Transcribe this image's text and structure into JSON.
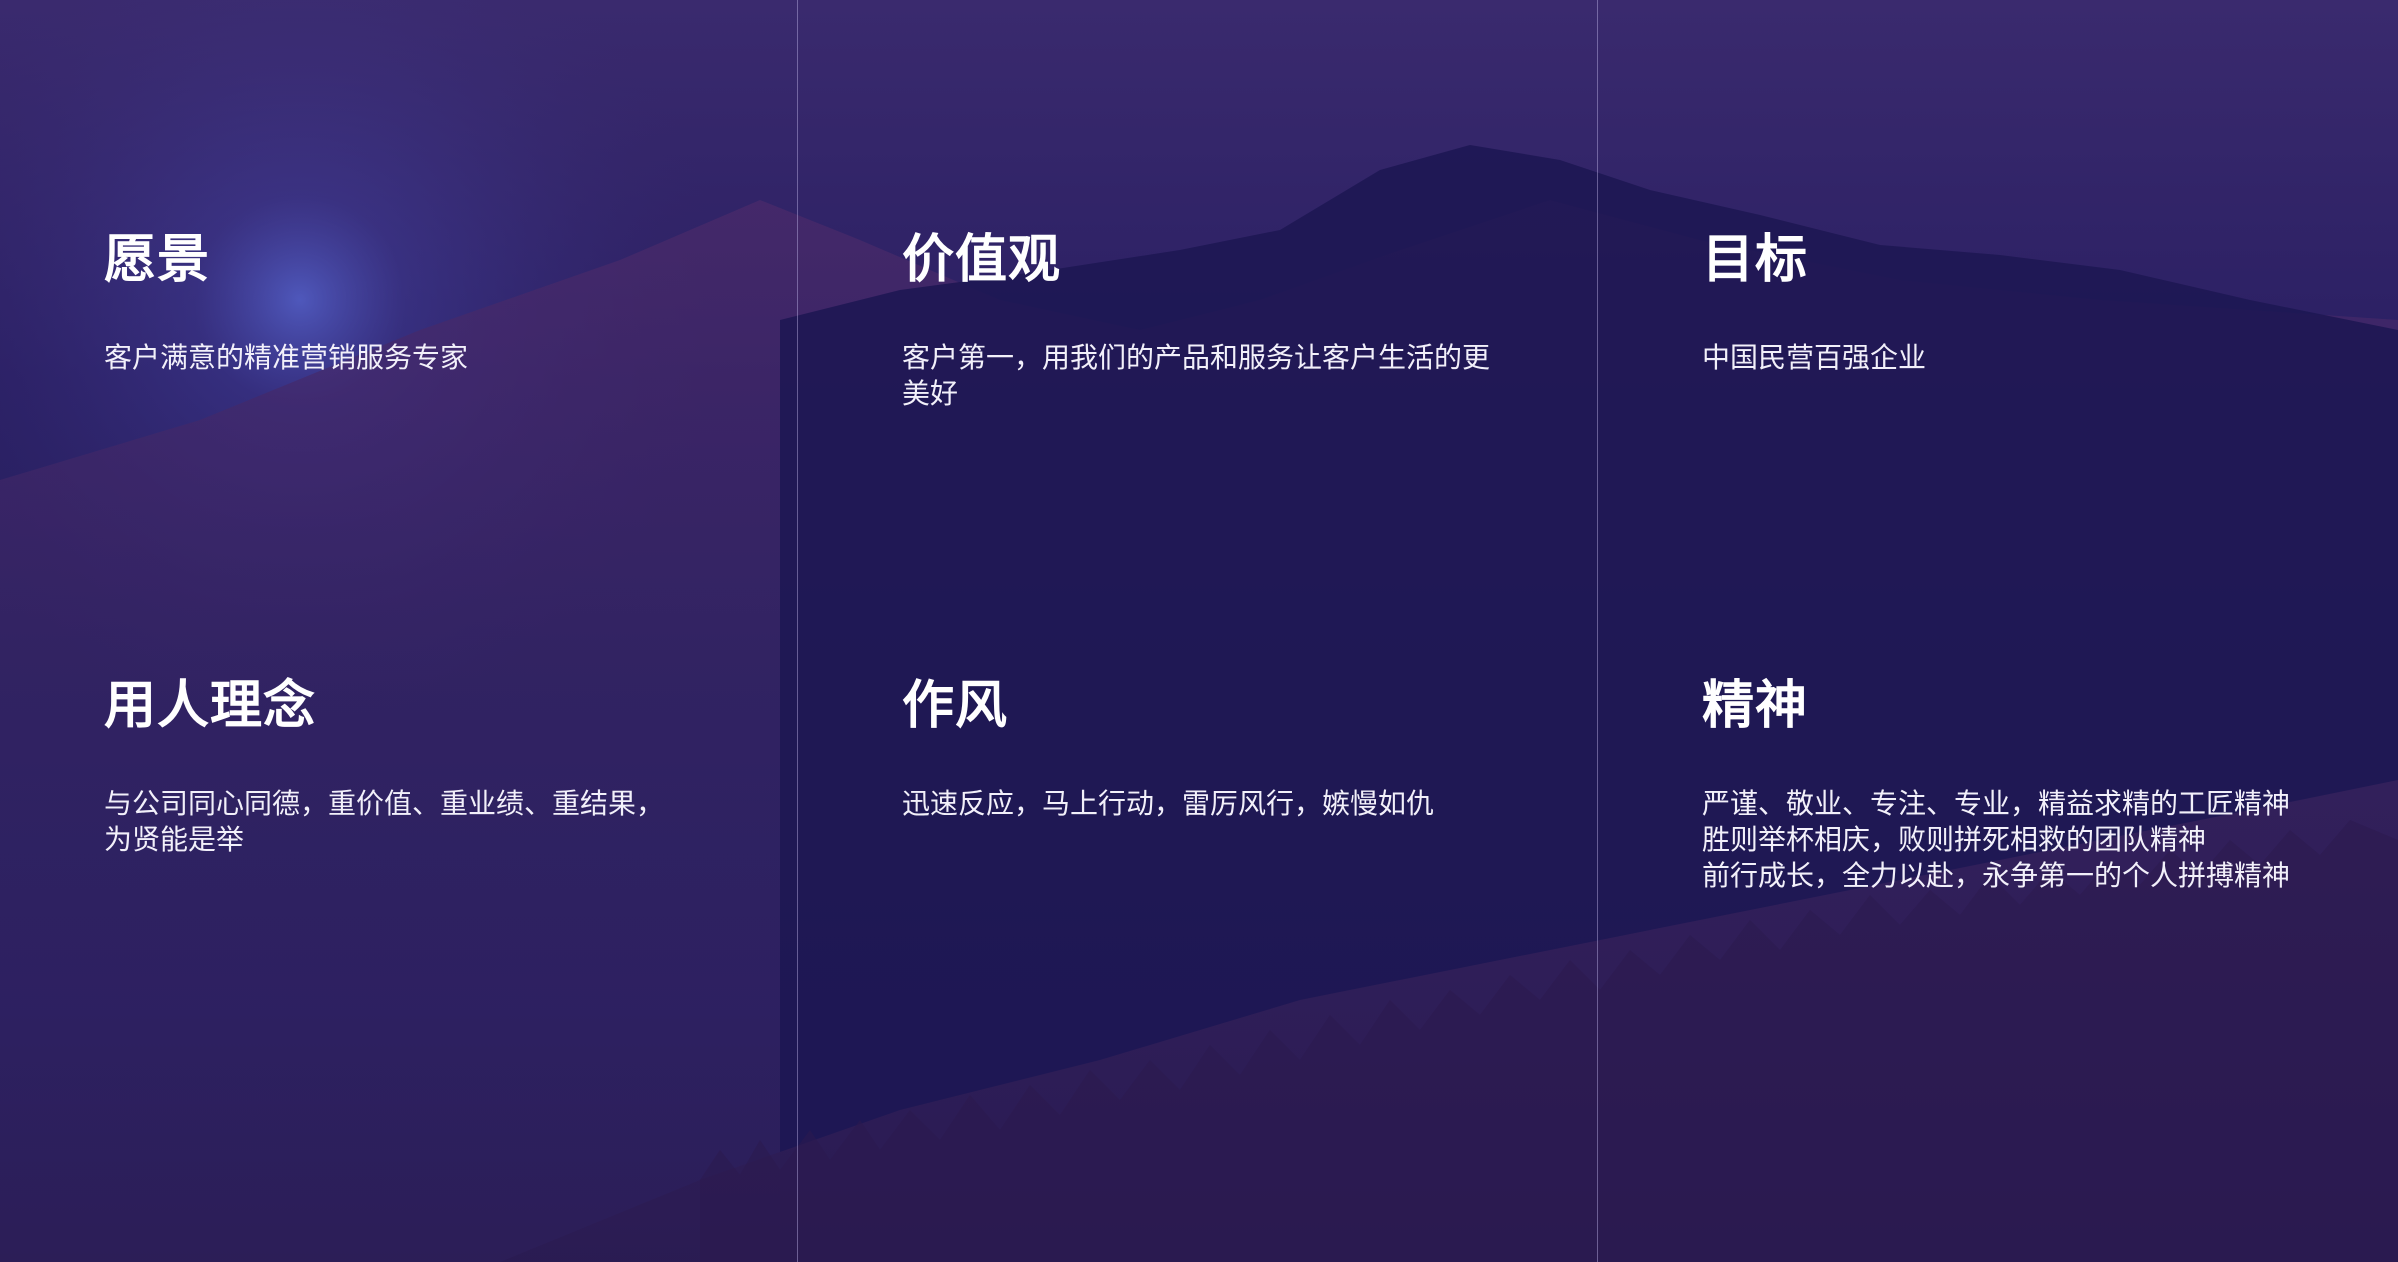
{
  "cards": [
    {
      "title": "愿景",
      "text": "客户满意的精准营销服务专家"
    },
    {
      "title": "价值观",
      "text": "客户第一，用我们的产品和服务让客户生活的更\n美好"
    },
    {
      "title": "目标",
      "text": "中国民营百强企业"
    },
    {
      "title": "用人理念",
      "text": "与公司同心同德，重价值、重业绩、重结果，\n为贤能是举"
    },
    {
      "title": "作风",
      "text": "迅速反应，马上行动，雷厉风行，嫉慢如仇"
    },
    {
      "title": "精神",
      "text": "严谨、敬业、专注、专业，精益求精的工匠精神\n胜则举杯相庆，败则拼死相救的团队精神\n前行成长，全力以赴，永争第一的个人拼搏精神"
    }
  ],
  "colors": {
    "background": "#2a1f63",
    "mountain": "#1a1550",
    "text": "#ffffff",
    "divider": "#beb4e6"
  }
}
